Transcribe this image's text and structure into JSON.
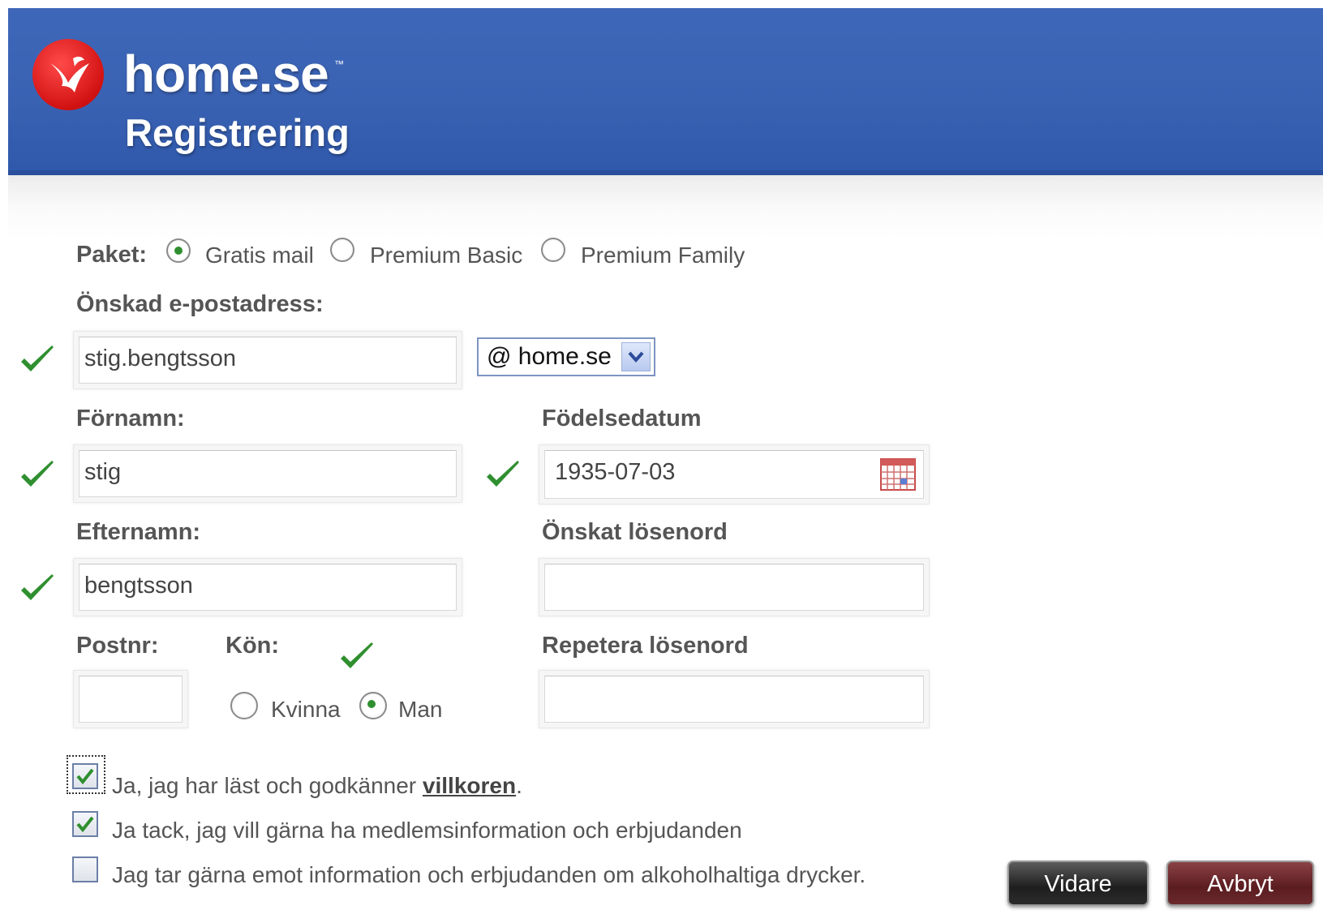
{
  "header": {
    "brand": "home.se",
    "trademark": "™",
    "subtitle": "Registrering"
  },
  "form": {
    "package": {
      "label": "Paket:",
      "options": [
        "Gratis mail",
        "Premium Basic",
        "Premium Family"
      ],
      "selected": "Gratis mail"
    },
    "email": {
      "label": "Önskad e-postadress:",
      "value": "stig.bengtsson",
      "domain": "@ home.se",
      "valid": true
    },
    "first_name": {
      "label": "Förnamn:",
      "value": "stig",
      "valid": true
    },
    "birthdate": {
      "label": "Födelsedatum",
      "value": "1935-07-03",
      "valid": true
    },
    "last_name": {
      "label": "Efternamn:",
      "value": "bengtsson",
      "valid": true
    },
    "password": {
      "label": "Önskat lösenord",
      "value": ""
    },
    "postal_code": {
      "label": "Postnr:",
      "value": ""
    },
    "gender": {
      "label": "Kön:",
      "options": [
        "Kvinna",
        "Man"
      ],
      "selected": "Man",
      "valid": true
    },
    "repeat_password": {
      "label": "Repetera lösenord",
      "value": ""
    },
    "checkboxes": {
      "terms_prefix": "Ja, jag har läst och godkänner ",
      "terms_link": "villkoren",
      "terms_suffix": ".",
      "terms_checked": true,
      "newsletter": "Ja tack, jag vill gärna ha medlemsinformation och erbjudanden",
      "newsletter_checked": true,
      "alcohol": "Jag tar gärna emot information och erbjudanden om alkoholhaltiga drycker.",
      "alcohol_checked": false
    },
    "buttons": {
      "next": "Vidare",
      "cancel": "Avbryt"
    }
  },
  "colors": {
    "header_blue": "#3a62b3",
    "logo_red": "#d21212",
    "valid_green": "#2f8f2f",
    "cancel_button": "#5b1c20",
    "next_button": "#1e1e1e"
  },
  "icons": [
    "bird-logo-icon",
    "checkmark-icon",
    "radio-icon",
    "calendar-icon",
    "chevron-down-icon",
    "checkbox-icon"
  ]
}
